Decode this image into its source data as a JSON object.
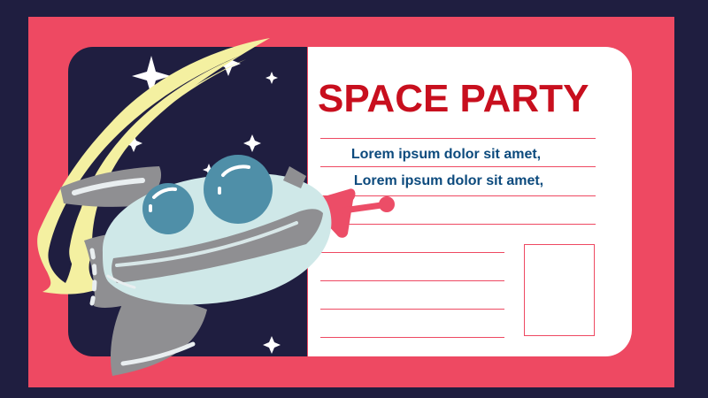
{
  "invitation": {
    "title": "SPACE PARTY",
    "lines": [
      "Lorem ipsum dolor sit amet,",
      "Lorem ipsum dolor sit amet,"
    ]
  },
  "colors": {
    "background": "#1f1e40",
    "card": "#ee4962",
    "title": "#c80f1e",
    "body_text": "#0c4a7d",
    "ship_body": "#cfe8e8",
    "ship_metal": "#8f8f92",
    "ship_dome": "#4f8fa8",
    "flame": "#f3eea0"
  },
  "icons": {
    "stars": "star-icon",
    "ship": "spaceship-icon",
    "trail": "comet-trail-icon"
  }
}
